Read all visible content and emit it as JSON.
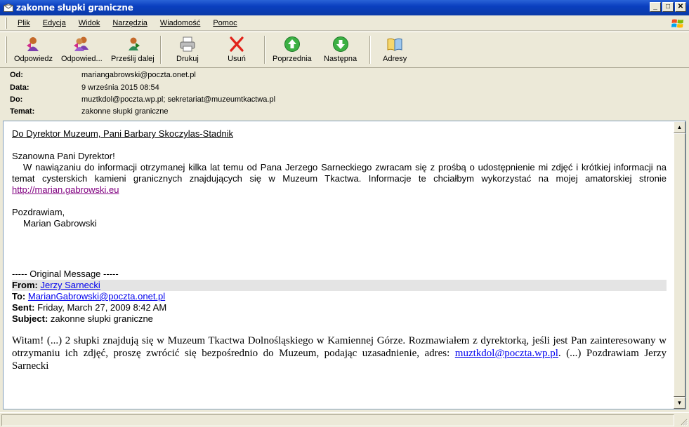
{
  "window": {
    "title": "zakonne słupki graniczne",
    "buttons": {
      "minimize": "_",
      "maximize": "□",
      "close": "✕"
    }
  },
  "menu": {
    "items": [
      "Plik",
      "Edycja",
      "Widok",
      "Narzędzia",
      "Wiadomość",
      "Pomoc"
    ]
  },
  "toolbar": {
    "reply": "Odpowiedz",
    "reply_all": "Odpowied...",
    "forward": "Prześlij dalej",
    "print": "Drukuj",
    "delete": "Usuń",
    "previous": "Poprzednia",
    "next": "Następna",
    "addresses": "Adresy"
  },
  "headers": {
    "from_label": "Od:",
    "from_value": "mariangabrowski@poczta.onet.pl",
    "date_label": "Data:",
    "date_value": "9 września 2015 08:54",
    "to_label": "Do:",
    "to_value": "muztkdol@poczta.wp.pl; sekretariat@muzeumtkactwa.pl",
    "subject_label": "Temat:",
    "subject_value": "zakonne słupki graniczne"
  },
  "body": {
    "recipient_line": "Do Dyrektor Muzeum, Pani Barbary Skoczylas-Stadnik",
    "greeting": "Szanowna Pani Dyrektor!",
    "paragraph": "W nawiązaniu do informacji otrzymanej kilka lat temu od Pana Jerzego Sarneckiego zwracam się z prośbą o udostępnienie mi zdjęć i krótkiej informacji na temat cysterskich kamieni granicznych znajdujących się w Muzeum Tkactwa. Informacje te chciałbym wykorzystać na mojej amatorskiej stronie",
    "site_link": "http://marian.gabrowski.eu",
    "closing": "Pozdrawiam,",
    "signature": "Marian Gabrowski",
    "original_header": "----- Original Message -----",
    "orig_from_label": "From:",
    "orig_from_value": "Jerzy Sarnecki",
    "orig_to_label": "To:",
    "orig_to_value": "MarianGabrowski@poczta.onet.pl",
    "orig_sent_label": "Sent:",
    "orig_sent_value": "Friday, March 27, 2009 8:42 AM",
    "orig_subject_label": "Subject:",
    "orig_subject_value": "zakonne słupki graniczne",
    "quoted_text_1": "Witam! (...) 2 słupki znajdują  się w Muzeum Tkactwa Dolnośląskiego w Kamiennej Górze. Rozmawiałem z dyrektorką, jeśli jest Pan zainteresowany w otrzymaniu ich zdjęć, proszę zwrócić się bezpośrednio do Muzeum, podając uzasadnienie, adres:",
    "quoted_link": "muztkdol@poczta.wp.pl",
    "quoted_text_2": ". (...) Pozdrawiam Jerzy Sarnecki"
  }
}
